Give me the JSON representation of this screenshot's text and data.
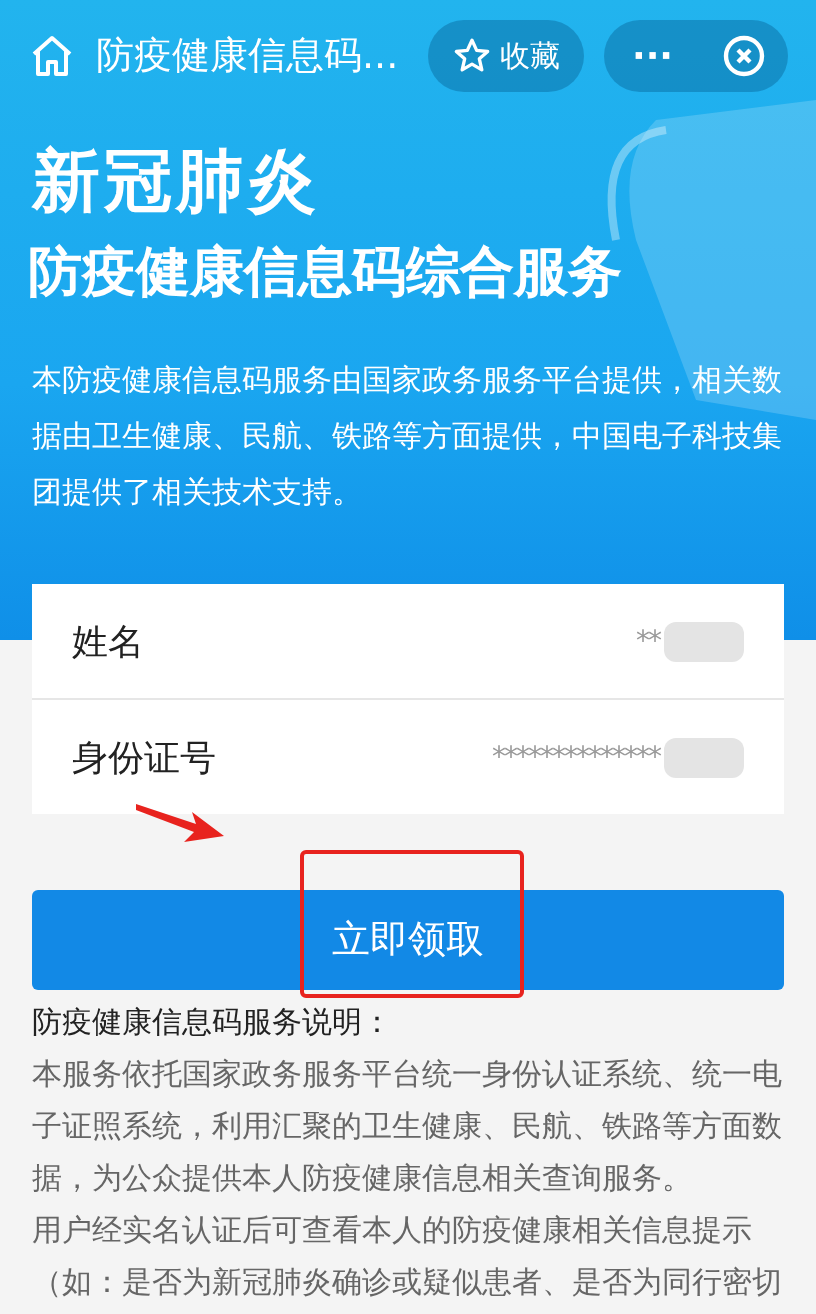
{
  "top_bar": {
    "title": "防疫健康信息码...",
    "favorite_label": "收藏",
    "more_label": "···"
  },
  "banner": {
    "headline": "新冠肺炎",
    "subheadline": "防疫健康信息码综合服务",
    "intro": "本防疫健康信息码服务由国家政务服务平台提供，相关数据由卫生健康、民航、铁路等方面提供，中国电子科技集团提供了相关技术支持。"
  },
  "form": {
    "rows": [
      {
        "label": "姓名",
        "value": "**"
      },
      {
        "label": "身份证号",
        "value": "**************"
      }
    ]
  },
  "submit_button": "立即领取",
  "description": {
    "title": "防疫健康信息码服务说明：",
    "paragraphs": [
      "本服务依托国家政务服务平台统一身份认证系统、统一电子证照系统，利用汇聚的卫生健康、民航、铁路等方面数据，为公众提供本人防疫健康信息相关查询服务。",
      "用户经实名认证后可查看本人的防疫健康相关信息提示（如：是否为新冠肺炎确诊或疑似患者、是否为同行密切"
    ]
  }
}
